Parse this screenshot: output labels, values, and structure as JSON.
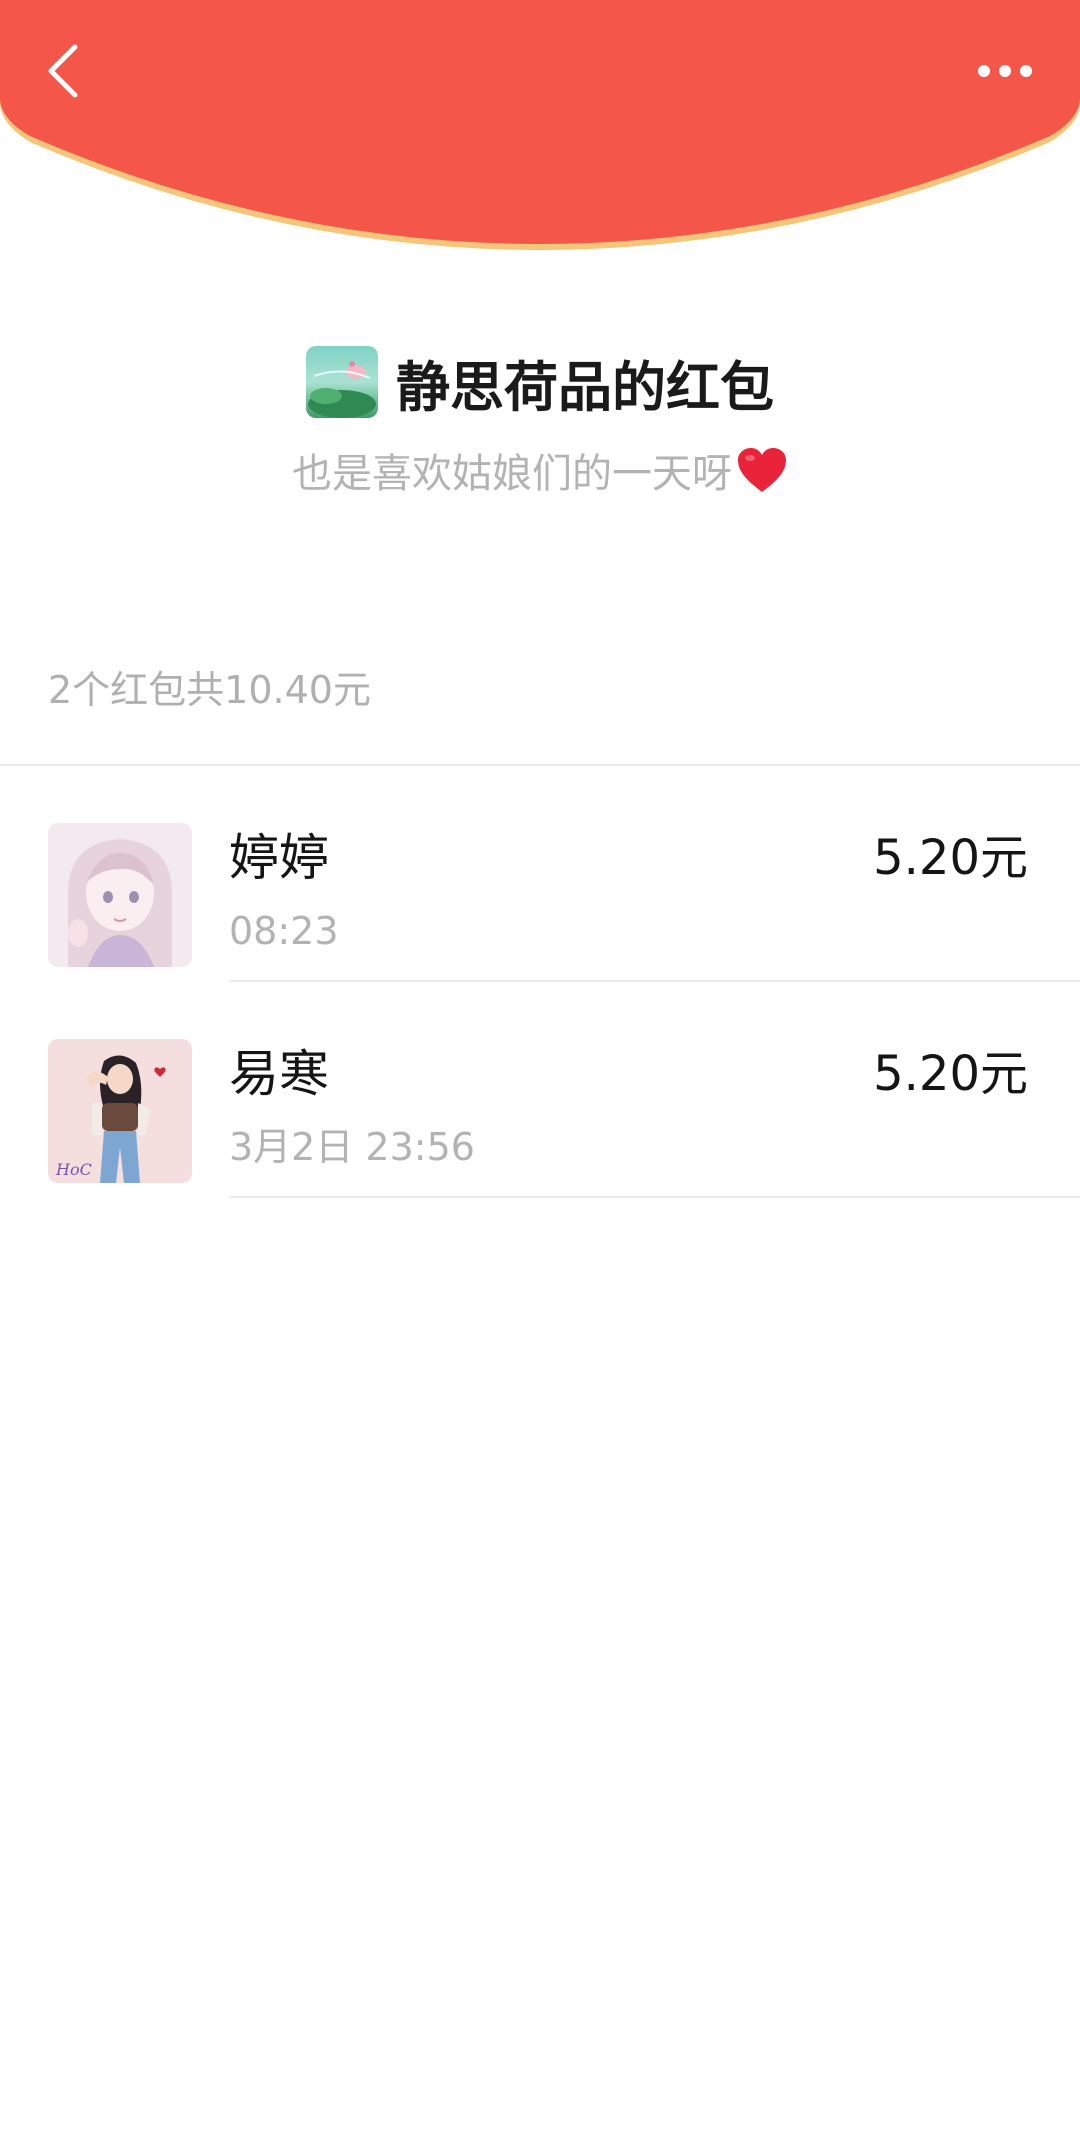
{
  "header": {
    "back_icon": "chevron-left-icon",
    "more_icon": "more-dots-icon",
    "colors": {
      "background": "#F5564A",
      "trim": "#F3C679"
    }
  },
  "sender": {
    "title": "静思荷品的红包",
    "greeting": "也是喜欢姑娘们的一天呀",
    "greeting_emoji": "heart-icon"
  },
  "summary": {
    "text": "2个红包共10.40元"
  },
  "recipients": [
    {
      "name": "婷婷",
      "time": "08:23",
      "amount": "5.20元"
    },
    {
      "name": "易寒",
      "time": "3月2日  23:56",
      "amount": "5.20元"
    }
  ]
}
